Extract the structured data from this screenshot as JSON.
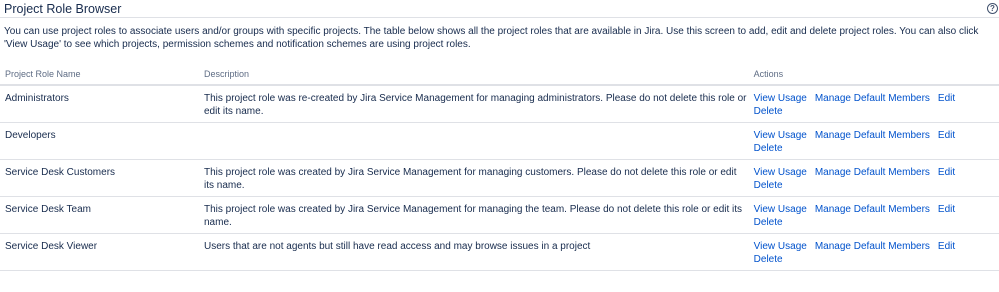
{
  "header": {
    "title": "Project Role Browser",
    "help_icon": "help-icon",
    "help_glyph": "?"
  },
  "intro": "You can use project roles to associate users and/or groups with specific projects. The table below shows all the project roles that are available in Jira. Use this screen to add, edit and delete project roles. You can also click 'View Usage' to see which projects, permission schemes and notification schemes are using project roles.",
  "table": {
    "headers": {
      "name": "Project Role Name",
      "description": "Description",
      "actions": "Actions"
    },
    "action_labels": {
      "view_usage": "View Usage",
      "manage_members": "Manage Default Members",
      "edit": "Edit",
      "delete": "Delete"
    },
    "rows": [
      {
        "name": "Administrators",
        "description": "This project role was re-created by Jira Service Management for managing administrators. Please do not delete this role or edit its name."
      },
      {
        "name": "Developers",
        "description": ""
      },
      {
        "name": "Service Desk Customers",
        "description": "This project role was created by Jira Service Management for managing customers. Please do not delete this role or edit its name."
      },
      {
        "name": "Service Desk Team",
        "description": "This project role was created by Jira Service Management for managing the team. Please do not delete this role or edit its name."
      },
      {
        "name": "Service Desk Viewer",
        "description": "Users that are not agents but still have read access and may browse issues in a project"
      }
    ]
  },
  "colors": {
    "link": "#0052cc",
    "text": "#172b4d",
    "header_text": "#5e6c84",
    "border": "#dfe1e6"
  }
}
